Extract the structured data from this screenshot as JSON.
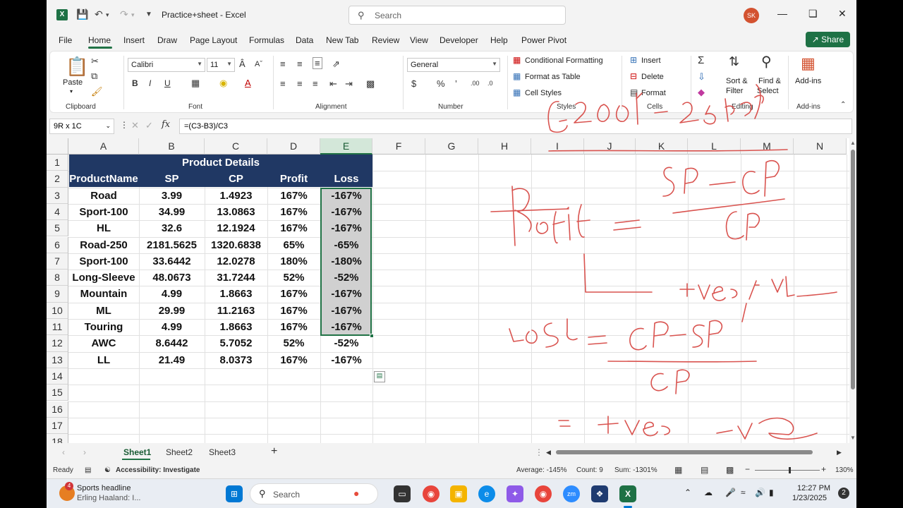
{
  "app": {
    "file_title": "Practice+sheet  -  Excel",
    "search_placeholder": "Search",
    "user_initials": "SK"
  },
  "menu": [
    "File",
    "Home",
    "Insert",
    "Draw",
    "Page Layout",
    "Formulas",
    "Data",
    "New Tab",
    "Review",
    "View",
    "Developer",
    "Help",
    "Power Pivot"
  ],
  "share_label": "Share",
  "ribbon": {
    "clipboard": {
      "paste": "Paste",
      "group": "Clipboard"
    },
    "font": {
      "name": "Calibri",
      "size": "11",
      "group": "Font"
    },
    "alignment": {
      "group": "Alignment"
    },
    "number": {
      "format": "General",
      "group": "Number"
    },
    "styles": {
      "conditional": "Conditional Formatting",
      "format_table": "Format as Table",
      "cell_styles": "Cell Styles",
      "group": "Styles"
    },
    "cells": {
      "insert": "Insert",
      "delete": "Delete",
      "format": "Format",
      "group": "Cells"
    },
    "editing": {
      "sort": "Sort &",
      "filter": "Filter",
      "find": "Find &",
      "select": "Select",
      "group": "Editing"
    },
    "addins": {
      "label": "Add-ins",
      "group": "Add-ins"
    }
  },
  "formula_bar": {
    "name_box": "9R x 1C",
    "formula": "=(C3-B3)/C3"
  },
  "grid": {
    "columns": [
      "A",
      "B",
      "C",
      "D",
      "E",
      "F",
      "G",
      "H",
      "I",
      "J",
      "K",
      "L",
      "M",
      "N"
    ],
    "rows": [
      "1",
      "2",
      "3",
      "4",
      "5",
      "6",
      "7",
      "8",
      "9",
      "10",
      "11",
      "12",
      "13",
      "14",
      "15",
      "16",
      "17",
      "18"
    ],
    "title": "Product Details",
    "headers": [
      "ProductName",
      "SP",
      "CP",
      "Profit",
      "Loss"
    ],
    "data": [
      [
        "Road",
        "3.99",
        "1.4923",
        "167%",
        "-167%"
      ],
      [
        "Sport-100",
        "34.99",
        "13.0863",
        "167%",
        "-167%"
      ],
      [
        "HL",
        "32.6",
        "12.1924",
        "167%",
        "-167%"
      ],
      [
        "Road-250",
        "2181.5625",
        "1320.6838",
        "65%",
        "-65%"
      ],
      [
        "Sport-100",
        "33.6442",
        "12.0278",
        "180%",
        "-180%"
      ],
      [
        "Long-Sleeve",
        "48.0673",
        "31.7244",
        "52%",
        "-52%"
      ],
      [
        "Mountain",
        "4.99",
        "1.8663",
        "167%",
        "-167%"
      ],
      [
        "ML",
        "29.99",
        "11.2163",
        "167%",
        "-167%"
      ],
      [
        "Touring",
        "4.99",
        "1.8663",
        "167%",
        "-167%"
      ],
      [
        "AWC",
        "8.6442",
        "5.7052",
        "52%",
        "-52%"
      ],
      [
        "LL",
        "21.49",
        "8.0373",
        "167%",
        "-167%"
      ]
    ]
  },
  "sheets": [
    "Sheet1",
    "Sheet2",
    "Sheet3"
  ],
  "status": {
    "ready": "Ready",
    "accessibility": "Accessibility: Investigate",
    "average": "Average: -145%",
    "count": "Count: 9",
    "sum": "Sum: -1301%",
    "zoom": "130%"
  },
  "taskbar": {
    "news_title": "Sports headline",
    "news_sub": "Erling Haaland: I...",
    "news_badge": "4",
    "search": "Search",
    "time": "12:27 PM",
    "date": "1/23/2025",
    "notif_count": "2"
  },
  "colors": {
    "excel_green": "#217346",
    "header_navy": "#203864",
    "ink_red": "#d9534f"
  }
}
